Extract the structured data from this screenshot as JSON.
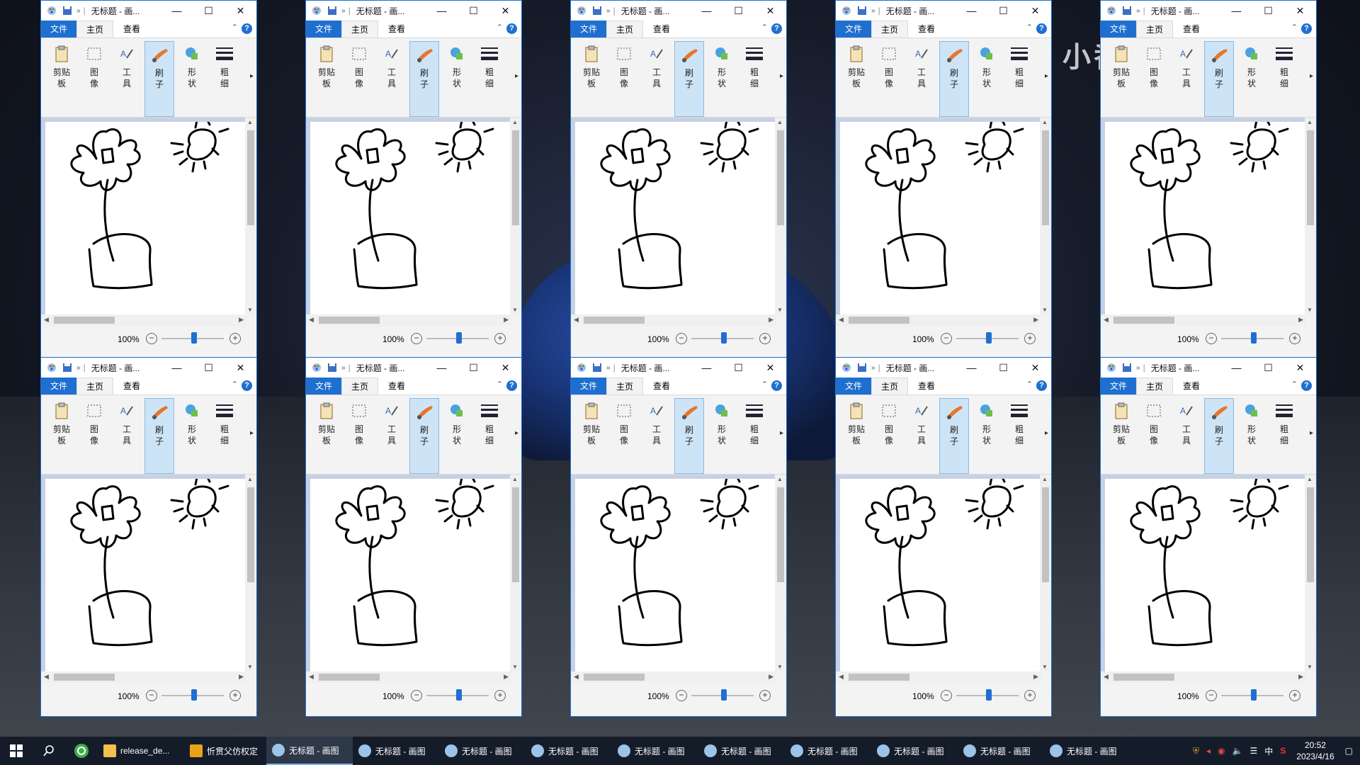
{
  "window": {
    "title": "无标题 - 画...",
    "file_label": "文件",
    "tabs": [
      "主页",
      "查看"
    ],
    "ribbon_groups": [
      {
        "label": "剪贴\n板",
        "icon": "clipboard-icon"
      },
      {
        "label": "图\n像",
        "icon": "image-select-icon"
      },
      {
        "label": "工\n具",
        "icon": "tools-icon"
      },
      {
        "label": "刷\n子",
        "icon": "brush-icon"
      },
      {
        "label": "形\n状",
        "icon": "shapes-icon"
      },
      {
        "label": "粗\n细",
        "icon": "line-size-icon"
      }
    ],
    "help_label": "?",
    "zoom": "100%"
  },
  "watermark": "小番茄 lilib",
  "taskbar": {
    "items": [
      {
        "label": "release_de...",
        "icon": "folder-icon"
      },
      {
        "label": "忻贯父仿权定",
        "icon": "app-icon"
      },
      {
        "label": "无标题 - 画图",
        "icon": "paint-icon"
      },
      {
        "label": "无标题 - 画图",
        "icon": "paint-icon"
      },
      {
        "label": "无标题 - 画图",
        "icon": "paint-icon"
      },
      {
        "label": "无标题 - 画图",
        "icon": "paint-icon"
      },
      {
        "label": "无标题 - 画图",
        "icon": "paint-icon"
      },
      {
        "label": "无标题 - 画图",
        "icon": "paint-icon"
      },
      {
        "label": "无标题 - 画图",
        "icon": "paint-icon"
      },
      {
        "label": "无标题 - 画图",
        "icon": "paint-icon"
      },
      {
        "label": "无标题 - 画图",
        "icon": "paint-icon"
      },
      {
        "label": "无标题 - 画图",
        "icon": "paint-icon"
      }
    ],
    "tray_lang": "中",
    "tray_ime": "S",
    "time": "20:52",
    "date": "2023/4/16"
  }
}
